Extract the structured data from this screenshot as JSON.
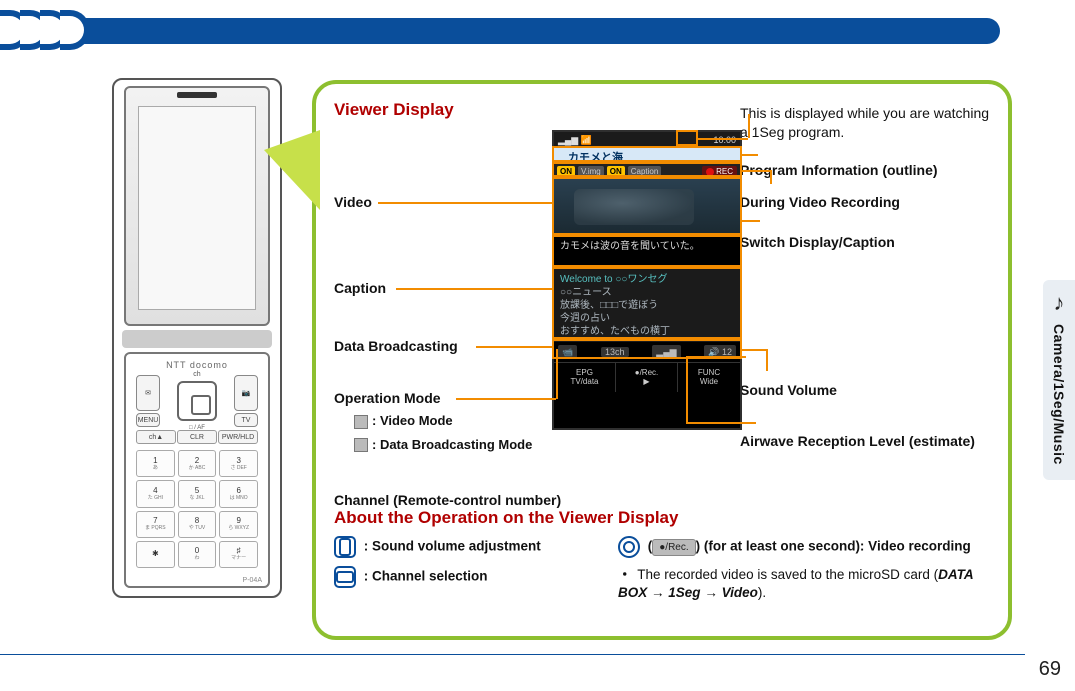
{
  "section_tab": {
    "icon": "♪",
    "label": "Camera/1Seg/Music"
  },
  "page_number": "69",
  "phone": {
    "brand": "NTT docomo",
    "model": "P-04A",
    "dpad_top": "ch",
    "dpad_bottom": "□ / AF",
    "nav_left_top": "✉",
    "nav_left_bottom": "MENU",
    "nav_right_top": "📷",
    "nav_right_bottom": "TV",
    "fn_left": "ch▲",
    "fn_mid": "CLR",
    "fn_right": "PWR/HLD",
    "keys": [
      {
        "n": "1",
        "s": "あ"
      },
      {
        "n": "2",
        "s": "か ABC"
      },
      {
        "n": "3",
        "s": "さ DEF"
      },
      {
        "n": "4",
        "s": "た GHI"
      },
      {
        "n": "5",
        "s": "な JKL"
      },
      {
        "n": "6",
        "s": "は MNO"
      },
      {
        "n": "7",
        "s": "ま PQRS"
      },
      {
        "n": "8",
        "s": "や TUV"
      },
      {
        "n": "9",
        "s": "ら WXYZ"
      },
      {
        "n": "✱",
        "s": ""
      },
      {
        "n": "0",
        "s": "わ"
      },
      {
        "n": "♯",
        "s": "マナー"
      }
    ]
  },
  "viewer": {
    "heading": "Viewer Display",
    "left": {
      "video": "Video",
      "caption": "Caption",
      "data_bc": "Data Broadcasting",
      "op_mode": "Operation Mode",
      "op_mode_video": ": Video Mode",
      "op_mode_data": ": Data Broadcasting Mode",
      "channel": "Channel (Remote-control number)"
    },
    "right": {
      "watching": "This is displayed while you are watching a 1Seg program.",
      "program_info": "Program Information (outline)",
      "during_rec": "During Video Recording",
      "switch_disp": "Switch Display/Caption",
      "sound_vol": "Sound Volume",
      "airwave": "Airwave Reception Level (estimate)"
    }
  },
  "screen": {
    "clock": "10:00",
    "program_title": "カモメと海",
    "chip_onv": "ON",
    "chip_vimg": "V.img",
    "chip_oncap": "ON",
    "chip_caption": "Caption",
    "rec": "REC",
    "caption_text": "カモメは波の音を聞いていた。",
    "databc_welcome": "Welcome to ○○ワンセグ",
    "databc_l1": "○○ニュース",
    "databc_l2": "放課後、□□□で遊ぼう",
    "databc_l3": "今週の占い",
    "databc_l4": "おすすめ、たべもの横丁",
    "bottom_mode": "📹",
    "bottom_ch": "13ch",
    "bottom_sig": "▂▄▆",
    "bottom_vol": "🔊 12",
    "soft_l1": "EPG",
    "soft_l2": "TV/data",
    "soft_m1": "●/Rec.",
    "soft_m2": "▶",
    "soft_r1": "FUNC",
    "soft_r2": "Wide"
  },
  "about": {
    "heading": "About the Operation on the Viewer Display",
    "vol_adj": ": Sound volume adjustment",
    "ch_sel": ": Channel selection",
    "rec_btn_label": "●/Rec.",
    "rec_line": "(for at least one second): Video recording",
    "rec_note_prefix": "The recorded video is saved to the microSD card (",
    "rec_note_path1": "DATA BOX",
    "rec_note_arrow": " → ",
    "rec_note_path2": "1Seg",
    "rec_note_path3": "Video",
    "rec_note_suffix": ")."
  }
}
